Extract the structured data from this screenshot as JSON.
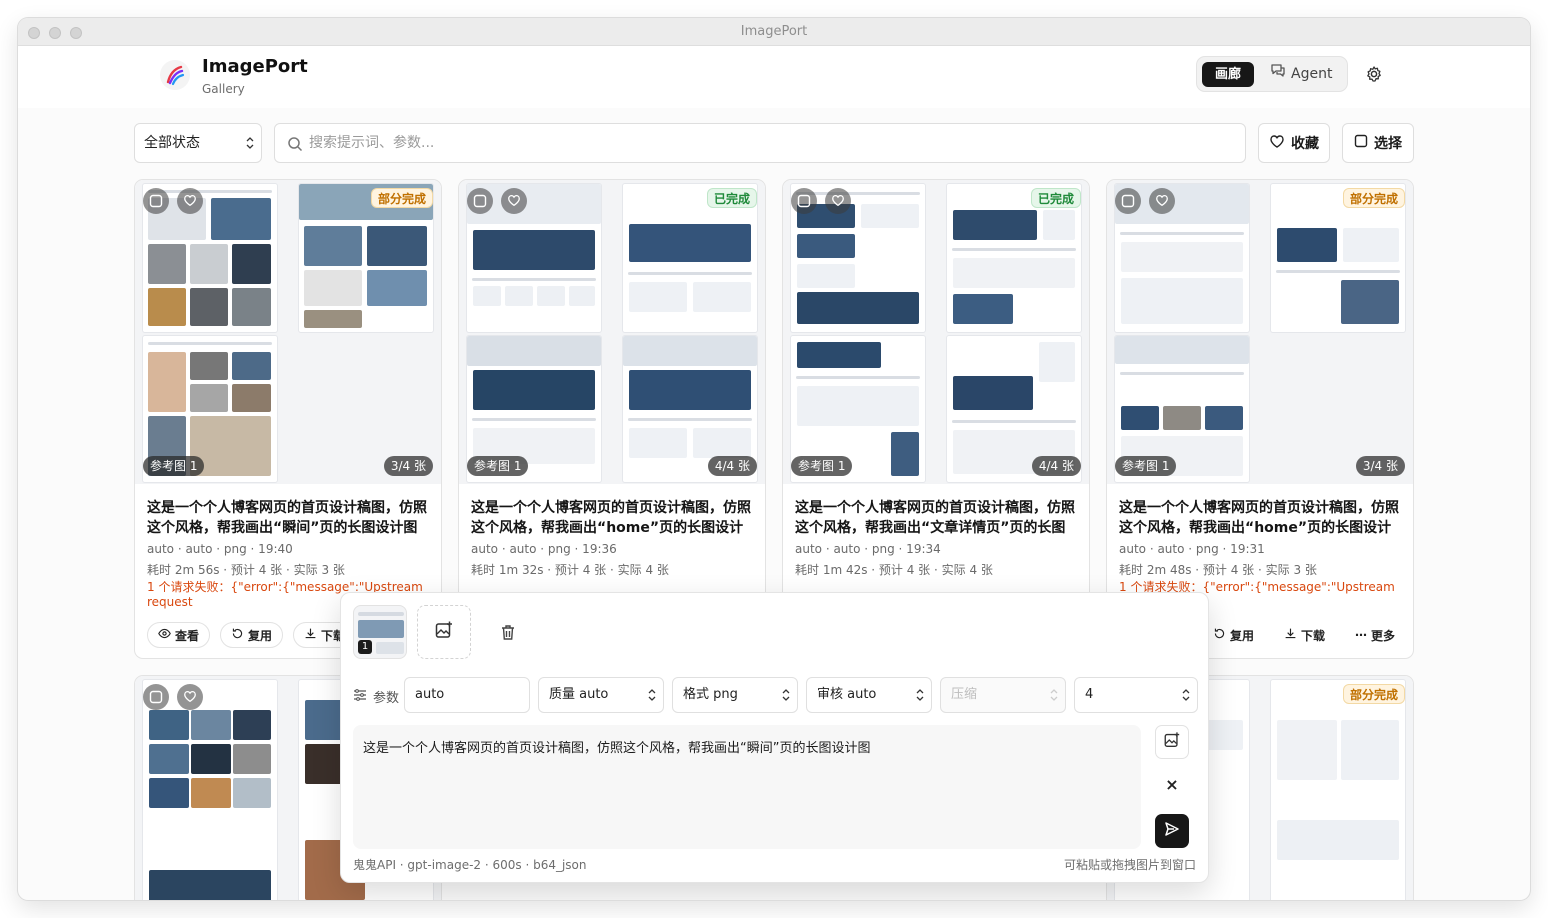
{
  "window": {
    "title": "ImagePort"
  },
  "brand": {
    "name": "ImagePort",
    "subtitle": "Gallery"
  },
  "nav": {
    "gallery_label": "画廊",
    "agent_label": "Agent"
  },
  "filters": {
    "status_value": "全部状态",
    "search_placeholder": "搜索提示词、参数...",
    "favorites_label": "收藏",
    "select_label": "选择"
  },
  "cards": [
    {
      "status": "部分完成",
      "status_kind": "partial",
      "ref_label": "参考图 1",
      "count": "3/4 张",
      "title": "这是一个个人博客网页的首页设计稿图，仿照这个风格，帮我画出“瞬间”页的长图设计图",
      "meta": "auto · auto · png · 19:40",
      "time": "耗时 2m 56s · 预计 4 张 · 实际 3 张",
      "error": "1 个请求失败：{\"error\":{\"message\":\"Upstream request failed\",\"type\":\"upstream_error\"}}event:..."
    },
    {
      "status": "已完成",
      "status_kind": "done",
      "ref_label": "参考图 1",
      "count": "4/4 张",
      "title": "这是一个个人博客网页的首页设计稿图，仿照这个风格，帮我画出“home”页的长图设计图",
      "meta": "auto · auto · png · 19:36",
      "time": "耗时 1m 32s · 预计 4 张 · 实际 4 张",
      "error": ""
    },
    {
      "status": "已完成",
      "status_kind": "done",
      "ref_label": "参考图 1",
      "count": "4/4 张",
      "title": "这是一个个人博客网页的首页设计稿图，仿照这个风格，帮我画出“文章详情页”页的长图设计图",
      "meta": "auto · auto · png · 19:34",
      "time": "耗时 1m 42s · 预计 4 张 · 实际 4 张",
      "error": ""
    },
    {
      "status": "部分完成",
      "status_kind": "partial",
      "ref_label": "参考图 1",
      "count": "3/4 张",
      "title": "这是一个个人博客网页的首页设计稿图，仿照这个风格，帮我画出“home”页的长图设计图",
      "meta": "auto · auto · png · 19:31",
      "time": "耗时 2m 48s · 预计 4 张 · 实际 3 张",
      "error": "1 个请求失败：{\"error\":{\"message\":\"Upstream request failed\",\"type\":\"upstream_error\"}}event:..."
    }
  ],
  "second_row": {
    "partial_badge": "部分完成"
  },
  "card_actions": {
    "view": "查看",
    "reuse": "复用",
    "download": "下载",
    "more": "更多"
  },
  "composer": {
    "attachment_number": "1",
    "params_label": "参数",
    "size_value": "auto",
    "quality_value": "质量 auto",
    "format_value": "格式 png",
    "moderation_value": "审核 auto",
    "compression_placeholder": "压缩",
    "count_value": "4",
    "prompt": "这是一个个人博客网页的首页设计稿图，仿照这个风格，帮我画出“瞬间”页的长图设计图",
    "footer_info": "鬼鬼API · gpt-image-2 · 600s · b64_json",
    "footer_hint": "可粘贴或拖拽图片到窗口"
  },
  "colors": {
    "accent_dark": "#171717",
    "partial_text": "#c07000",
    "done_text": "#1f8a3a",
    "error_text": "#d9480f"
  },
  "icons": [
    "app-logo-icon",
    "chat-icon",
    "gear-icon",
    "search-icon",
    "heart-icon",
    "square-icon",
    "eye-icon",
    "refresh-icon",
    "download-icon",
    "more-icon",
    "image-add-icon",
    "trash-icon",
    "sliders-icon",
    "close-icon",
    "send-icon"
  ]
}
